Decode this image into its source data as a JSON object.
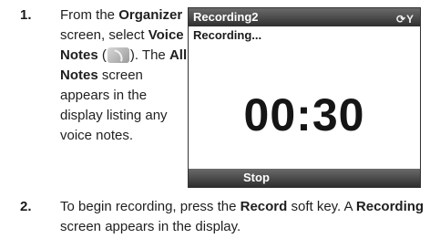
{
  "steps": [
    {
      "number": "1.",
      "parts": {
        "a": "From the ",
        "b": "Organizer",
        "c": " screen, select ",
        "d": "Voice Notes",
        "e": " (",
        "f": "). The ",
        "g": "All Notes",
        "h": " screen appears in the display listing any voice notes."
      }
    },
    {
      "number": "2.",
      "parts": {
        "a": "To begin recording, press the ",
        "b": "Record",
        "c": " soft key. A ",
        "d": "Recording",
        "e": " screen appears in the display."
      }
    }
  ],
  "phone_screen": {
    "title": "Recording2",
    "status_icons": "⟳Y",
    "status_label": "Recording...",
    "timer": "00:30",
    "softkey_left": "Stop"
  }
}
